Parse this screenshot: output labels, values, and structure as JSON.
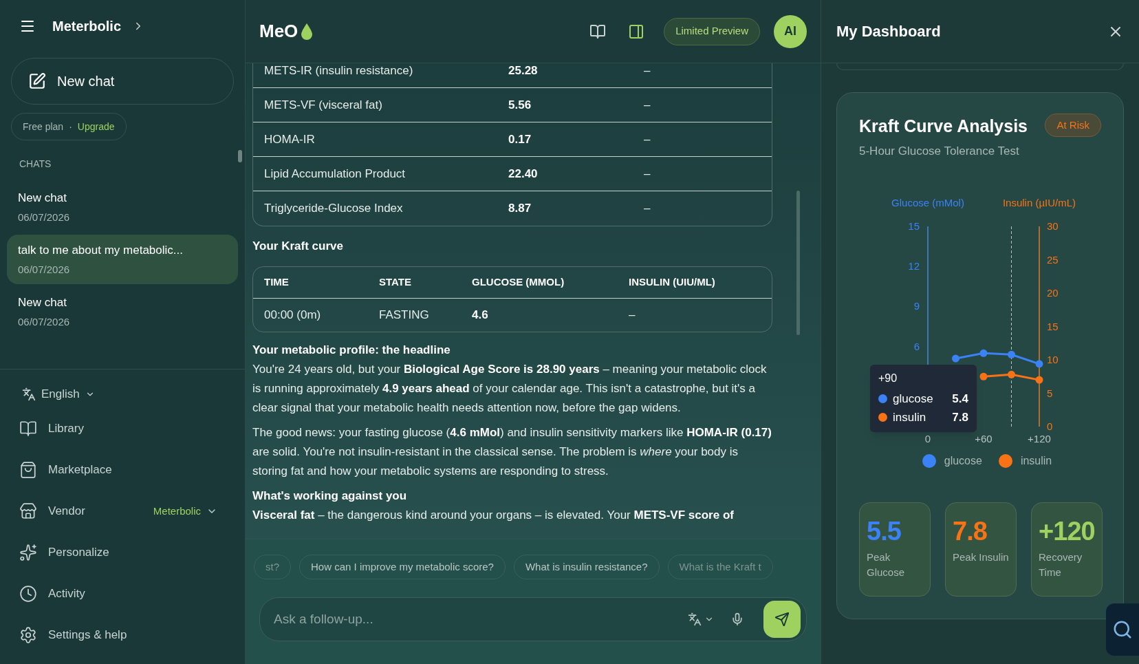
{
  "sidebar": {
    "title": "Meterbolic",
    "new_chat": "New chat",
    "plan": {
      "label": "Free plan",
      "separator": "·",
      "action": "Upgrade"
    },
    "section_label": "CHATS",
    "chats": [
      {
        "title": "New chat",
        "date": "06/07/2026",
        "selected": false
      },
      {
        "title": "talk to me about my metabolic...",
        "date": "06/07/2026",
        "selected": true
      },
      {
        "title": "New chat",
        "date": "06/07/2026",
        "selected": false
      }
    ],
    "language": "English",
    "nav": [
      {
        "label": "Library"
      },
      {
        "label": "Marketplace"
      },
      {
        "label": "Vendor",
        "value": "Meterbolic"
      },
      {
        "label": "Personalize"
      },
      {
        "label": "Activity"
      },
      {
        "label": "Settings & help"
      }
    ]
  },
  "chat": {
    "brand": "MeO",
    "preview_badge": "Limited Preview",
    "avatar": "AI",
    "metrics_table": {
      "rows": [
        [
          "METS-IR (insulin resistance)",
          "25.28",
          "–"
        ],
        [
          "METS-VF (visceral fat)",
          "5.56",
          "–"
        ],
        [
          "HOMA-IR",
          "0.17",
          "–"
        ],
        [
          "Lipid Accumulation Product",
          "22.40",
          "–"
        ],
        [
          "Triglyceride-Glucose Index",
          "8.87",
          "–"
        ]
      ]
    },
    "kraft_heading": "Your Kraft curve",
    "kraft_table": {
      "columns": [
        "TIME",
        "STATE",
        "GLUCOSE (MMOL)",
        "INSULIN (UIU/ML)"
      ],
      "rows": [
        [
          "00:00 (0m)",
          "FASTING",
          "4.6",
          "–"
        ]
      ]
    },
    "blocks": [
      {
        "kind": "heading",
        "text": "Your metabolic profile: the headline"
      },
      {
        "kind": "paragraph",
        "text": "You're 24 years old, but your **Biological Age Score is 28.90 years** – meaning your metabolic clock is running approximately **4.9 years ahead** of your calendar age. This isn't a catastrophe, but it's a clear signal that your metabolic health needs attention now, before the gap widens."
      },
      {
        "kind": "paragraph",
        "text": "The good news: your fasting glucose (**4.6 mMol**) and insulin sensitivity markers like **HOMA-IR (0.17)** are solid. You're not insulin-resistant in the classical sense. The problem is *where* your body is storing fat and how your metabolic systems are responding to stress."
      },
      {
        "kind": "heading",
        "text": "What's working against you"
      },
      {
        "kind": "paragraph",
        "text": "**Visceral fat** – the dangerous kind around your organs – is elevated. Your **METS-VF score of**"
      }
    ],
    "suggestions": [
      "st?",
      "How can I improve my metabolic score?",
      "What is insulin resistance?",
      "What is the Kraft t"
    ],
    "input": {
      "placeholder": "Ask a follow-up..."
    }
  },
  "dashboard": {
    "title": "My Dashboard",
    "card": {
      "title": "Kraft Curve Analysis",
      "subtitle": "5-Hour Glucose Tolerance Test",
      "status": "At Risk",
      "chart_data": {
        "type": "line",
        "x": [
          30,
          60,
          90,
          120
        ],
        "xlim": [
          0,
          120
        ],
        "ref_lines": [
          {
            "axis": "x",
            "value": 90
          }
        ],
        "series": [
          {
            "name": "glucose",
            "color": "#3b82f6",
            "marker": "circle",
            "values": [
              5.1,
              5.5,
              5.4,
              4.7
            ]
          },
          {
            "name": "insulin",
            "color": "#f97316",
            "marker": "circle",
            "axis": "y2",
            "values": [
              null,
              7.5,
              7.8,
              7.0
            ]
          }
        ],
        "legend": "bottom",
        "ylabel": "Glucose (mMol)",
        "y2label": "Insulin (µIU/mL)",
        "ylim": [
          0,
          15
        ],
        "y2lim": [
          0,
          30
        ],
        "yticks": [
          {
            "value": 6,
            "label": "6"
          },
          {
            "value": 9,
            "label": "9"
          },
          {
            "value": 12,
            "label": "12"
          },
          {
            "value": 15,
            "label": "15"
          }
        ],
        "y2ticks": [
          {
            "value": 0,
            "label": "0"
          },
          {
            "value": 5,
            "label": "5"
          },
          {
            "value": 10,
            "label": "10"
          },
          {
            "value": 15,
            "label": "15"
          },
          {
            "value": 20,
            "label": "20"
          },
          {
            "value": 25,
            "label": "25"
          },
          {
            "value": 30,
            "label": "30"
          }
        ],
        "xticks": [
          {
            "value": 0,
            "label": "0"
          },
          {
            "value": 60,
            "label": "+60"
          },
          {
            "value": 120,
            "label": "+120"
          }
        ]
      },
      "tooltip": {
        "title": "+90",
        "items": [
          {
            "name": "glucose",
            "value": "5.4",
            "color": "#3b82f6"
          },
          {
            "name": "insulin",
            "value": "7.8",
            "color": "#f97316"
          }
        ]
      },
      "stats": [
        {
          "value": "5.5",
          "label": "Peak Glucose",
          "color": "#3b82f6"
        },
        {
          "value": "7.8",
          "label": "Peak Insulin",
          "color": "#f97316"
        },
        {
          "value": "+120",
          "label": "Recovery Time",
          "color": "#9ed15f"
        }
      ]
    }
  }
}
